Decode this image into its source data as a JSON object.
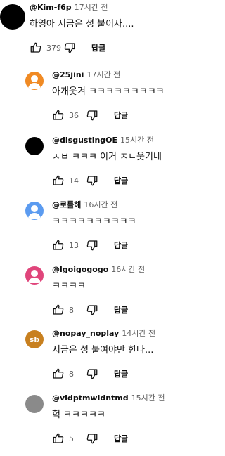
{
  "comments": [
    {
      "handle": "@Kim-f6p",
      "time": "17시간 전",
      "text": "하영아 지금은 성 붙이자....",
      "likes": "379",
      "reply_label": "답글",
      "avatar": {
        "color": "#000000",
        "initials": ""
      }
    },
    {
      "handle": "@25jini",
      "time": "17시간 전",
      "text": "아개웃겨 ㅋㅋㅋㅋㅋㅋㅋㅋㅋ",
      "likes": "36",
      "reply_label": "답글",
      "avatar": {
        "color": "#f08a24",
        "initials": "",
        "icon": "person-icon"
      }
    },
    {
      "handle": "@disgustingOE",
      "time": "15시간 전",
      "text": "ㅅㅂ ㅋㅋㅋ 이거 ㅈㄴ웃기네",
      "likes": "14",
      "reply_label": "답글",
      "avatar": {
        "color": "#000000",
        "initials": ""
      }
    },
    {
      "handle": "@로롤해",
      "time": "16시간 전",
      "text": "ㅋㅋㅋㅋㅋㅋㅋㅋㅋㅋ",
      "likes": "13",
      "reply_label": "답글",
      "avatar": {
        "color": "#5b9bf0",
        "initials": "",
        "icon": "person-icon"
      }
    },
    {
      "handle": "@lgoigogogo",
      "time": "16시간 전",
      "text": "ㅋㅋㅋㅋ",
      "likes": "8",
      "reply_label": "답글",
      "avatar": {
        "color": "#e0457b",
        "initials": "",
        "icon": "person-icon"
      }
    },
    {
      "handle": "@nopay_noplay",
      "time": "14시간 전",
      "text": "지금은 성 붙여야만 한다...",
      "likes": "8",
      "reply_label": "답글",
      "avatar": {
        "color": "#c8801f",
        "initials": "sb"
      }
    },
    {
      "handle": "@vldptmwldntmd",
      "time": "15시간 전",
      "text": "헉 ㅋㅋㅋㅋㅋ",
      "likes": "5",
      "reply_label": "답글",
      "avatar": {
        "color": "#8a8a8a",
        "initials": ""
      }
    }
  ],
  "icons": {
    "like": "thumbs-up-icon",
    "dislike": "thumbs-down-icon"
  }
}
